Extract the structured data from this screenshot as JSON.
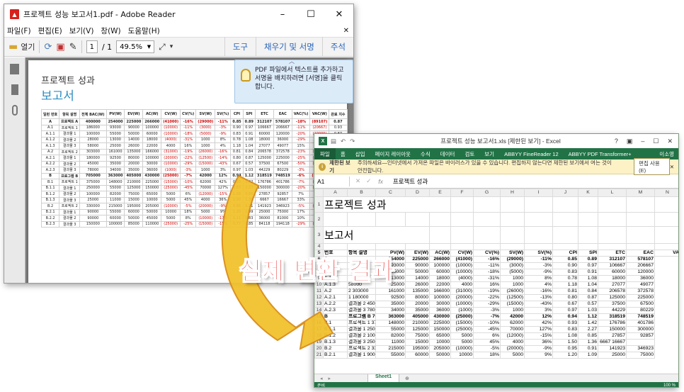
{
  "reader": {
    "title": "프로젝트 성능 보고서1.pdf - Adobe Reader",
    "menu": [
      "파일(F)",
      "편집(E)",
      "보기(V)",
      "창(W)",
      "도움말(H)"
    ],
    "toolbar": {
      "open": "열기",
      "page_current": "1",
      "page_total": "/ 1",
      "zoom": "49.5%"
    },
    "right_tabs": [
      "도구",
      "채우기 및 서명",
      "주석"
    ],
    "tip_text": "PDF 파일에서 텍스트를 추가하고 서명을 배치하려면 [서명]을 클릭합니다.",
    "page_heading": "프로젝트 성과",
    "page_subheading": "보고서",
    "table_headers": [
      "일런 번호",
      "항목 설명",
      "전체 BAC(W)",
      "PV(W)",
      "EV(W)",
      "AC(W)",
      "CV(W)",
      "CV(%)",
      "SV(W)",
      "SV(%)",
      "CPI",
      "SPI",
      "ETC",
      "EAC",
      "VAC(%)",
      "VAC(W)",
      "완료 지수"
    ],
    "table_rows": [
      [
        "A",
        "프로젝트 A",
        "400000",
        "254000",
        "225000",
        "266000",
        "(41000)",
        "-16%",
        "(29000)",
        "-11%",
        "0.85",
        "0.89",
        "312107",
        "578107",
        "-18%",
        "(89107)",
        "0.87"
      ],
      [
        "A.1",
        "프로젝트 1",
        "186000",
        "93000",
        "90000",
        "100000",
        "(10000)",
        "-11%",
        "(3000)",
        "-3%",
        "0.90",
        "0.97",
        "106667",
        "206667",
        "-11%",
        "(20667)",
        "0.93"
      ],
      [
        "A.1.1",
        "결과물 1",
        "100000",
        "55000",
        "50000",
        "60000",
        "(10000)",
        "-18%",
        "(5000)",
        "-9%",
        "0.83",
        "0.91",
        "60000",
        "120000",
        "-20%",
        "(20000)",
        "0.87"
      ],
      [
        "A.1.2",
        "결과물 2",
        "28000",
        "13000",
        "14000",
        "18000",
        "(4000)",
        "-31%",
        "1000",
        "8%",
        "0.78",
        "1.08",
        "18000",
        "36000",
        "-29%",
        "(8000)",
        "0.83"
      ],
      [
        "A.1.3",
        "결과물 3",
        "58000",
        "25000",
        "26000",
        "22000",
        "4000",
        "16%",
        "1000",
        "4%",
        "1.18",
        "1.04",
        "27077",
        "49077",
        "15%",
        "8923",
        "1.11"
      ],
      [
        "A.2",
        "프로젝트 2",
        "303000",
        "161000",
        "135000",
        "166000",
        "(31000)",
        "-19%",
        "(26000)",
        "-16%",
        "0.81",
        "0.84",
        "206578",
        "372578",
        "-23%",
        "(69578)",
        "0.83"
      ],
      [
        "A.2.1",
        "결과물 1",
        "180000",
        "92500",
        "80000",
        "100000",
        "(20000)",
        "-22%",
        "(12500)",
        "-14%",
        "0.80",
        "0.87",
        "125000",
        "225000",
        "-25%",
        "(45000)",
        "0.83"
      ],
      [
        "A.2.2",
        "결과물 2",
        "45000",
        "35000",
        "20000",
        "30000",
        "(10000)",
        "-29%",
        "(15000)",
        "-43%",
        "0.67",
        "0.57",
        "37500",
        "67500",
        "-50%",
        "(22500)",
        "0.61"
      ],
      [
        "A.2.3",
        "결과물 3",
        "78000",
        "34000",
        "35000",
        "36000",
        "(1000)",
        "-3%",
        "1000",
        "3%",
        "0.97",
        "1.03",
        "44229",
        "80229",
        "-3%",
        "(2229)",
        "1.00"
      ],
      [
        "B",
        "프로그램 B",
        "705000",
        "363000",
        "405000",
        "430000",
        "(25000)",
        "-7%",
        "42000",
        "12%",
        "0.94",
        "1.12",
        "318519",
        "748519",
        "-6%",
        "(43519)",
        "1.02"
      ],
      [
        "B.1",
        "프로젝트 1",
        "375000",
        "148000",
        "210000",
        "225000",
        "(15000)",
        "-10%",
        "62000",
        "42%",
        "0.93",
        "1.42",
        "176786",
        "401786",
        "-7%",
        "(26786)",
        "1.12"
      ],
      [
        "B.1.1",
        "결과물 1",
        "250000",
        "55000",
        "125000",
        "150000",
        "(25000)",
        "-45%",
        "70000",
        "127%",
        "0.83",
        "2.27",
        "150000",
        "300000",
        "-20%",
        "(50000)",
        "1.30"
      ],
      [
        "B.1.2",
        "결과물 2",
        "100000",
        "82000",
        "75000",
        "65000",
        "5000",
        "6%",
        "(12000)",
        "-15%",
        "1.08",
        "0.85",
        "27857",
        "92857",
        "7%",
        "7143",
        "0.97"
      ],
      [
        "B.1.3",
        "결과물 3",
        "25000",
        "11000",
        "15000",
        "10000",
        "5000",
        "45%",
        "4000",
        "36%",
        "1.50",
        "1.36",
        "6667",
        "16667",
        "33%",
        "8333",
        "1.43"
      ],
      [
        "B.2",
        "프로젝트 2",
        "330000",
        "215000",
        "195000",
        "205000",
        "(10000)",
        "-5%",
        "(20000)",
        "-9%",
        "0.95",
        "0.91",
        "141923",
        "346923",
        "-5%",
        "(16923)",
        "0.93"
      ],
      [
        "B.2.1",
        "결과물 1",
        "90000",
        "55000",
        "60000",
        "50000",
        "10000",
        "18%",
        "5000",
        "9%",
        "1.20",
        "1.09",
        "25000",
        "75000",
        "17%",
        "15000",
        "1.15"
      ],
      [
        "B.2.2",
        "결과물 2",
        "90000",
        "60000",
        "50000",
        "45000",
        "5000",
        "8%",
        "(10000)",
        "-17%",
        "1.11",
        "0.83",
        "36000",
        "81000",
        "10%",
        "9000",
        "0.97"
      ],
      [
        "B.2.3",
        "결과물 3",
        "150000",
        "100000",
        "85000",
        "110000",
        "(25000)",
        "-25%",
        "(15000)",
        "-15%",
        "0.77",
        "0.85",
        "84118",
        "194118",
        "-29%",
        "(44118)",
        "0.81"
      ]
    ]
  },
  "excel": {
    "title": "프로젝트 성능 보고서1.xls [제한된 보기] - Excel",
    "ribbon_tabs": [
      "파일",
      "홈",
      "삽입",
      "페이지 레이아웃",
      "수식",
      "데이터",
      "검토",
      "보기",
      "ABBYY FineReader 12",
      "ABBYY PDF Transformer+"
    ],
    "user": "이소영",
    "warning_label": "제한된 보기",
    "warning_text": "주의하세요—인터넷에서 가져온 파일은 바이러스가 있을 수 있습니다. 편집하지 않는다면 제한된 보기에서 여는 것이 안전합니다.",
    "enable_edit": "편집 사용(E)",
    "name_box": "A1",
    "fx": "fx",
    "formula_value": "프로젝트 성과",
    "columns": [
      "A",
      "B",
      "C",
      "D",
      "E",
      "F",
      "G",
      "H",
      "I",
      "J",
      "K",
      "L",
      "M",
      "N"
    ],
    "cell_a1": "프로젝트 성과",
    "cell_a3": "보고서",
    "header_row": [
      "번호",
      "항목 설명",
      "PV(W)",
      "EV(W)",
      "AC(W)",
      "CV(W)",
      "CV(%)",
      "SV(W)",
      "SV(%)",
      "CPI",
      "SPI",
      "ETC",
      "EAC",
      "VA"
    ],
    "rows": [
      [
        "6",
        "A",
        "",
        "254000",
        "225000",
        "266000",
        "(41000)",
        "-16%",
        "(29000)",
        "-11%",
        "0.85",
        "0.89",
        "312107",
        "578107"
      ],
      [
        "7",
        "A.1",
        "",
        "93000",
        "90000",
        "100000",
        "(10000)",
        "-11%",
        "(3000)",
        "-3%",
        "0.90",
        "0.97",
        "106667",
        "206667"
      ],
      [
        "8",
        "A.1.1",
        "",
        "55000",
        "50000",
        "60000",
        "(10000)",
        "-18%",
        "(5000)",
        "-9%",
        "0.83",
        "0.91",
        "60000",
        "120000"
      ],
      [
        "9",
        "A.1.2",
        "",
        "13000",
        "14000",
        "18000",
        "(4000)",
        "-31%",
        "1000",
        "8%",
        "0.78",
        "1.08",
        "18000",
        "36000"
      ],
      [
        "10",
        "A.1.3",
        "58000",
        "25000",
        "26000",
        "22000",
        "4000",
        "16%",
        "1000",
        "4%",
        "1.18",
        "1.04",
        "27077",
        "49077"
      ],
      [
        "11",
        "A.2",
        "2 303000",
        "161000",
        "135000",
        "166000",
        "(31000)",
        "-19%",
        "(26000)",
        "-16%",
        "0.81",
        "0.84",
        "206578",
        "372578"
      ],
      [
        "12",
        "A.2.1",
        "1 180000",
        "92500",
        "80000",
        "100000",
        "(20000)",
        "-22%",
        "(12500)",
        "-13%",
        "0.80",
        "0.87",
        "125000",
        "225000"
      ],
      [
        "13",
        "A.2.2",
        "결과물 2 45000",
        "35000",
        "20000",
        "30000",
        "(10000)",
        "-29%",
        "(15000)",
        "-43%",
        "0.67",
        "0.57",
        "37500",
        "67500"
      ],
      [
        "14",
        "A.2.3",
        "결과물 3 78000",
        "34000",
        "35000",
        "36000",
        "(1000)",
        "-3%",
        "1000",
        "3%",
        "0.97",
        "1.03",
        "44229",
        "80229"
      ],
      [
        "15",
        "B",
        "프로그램 B 705000",
        "363000",
        "405000",
        "430000",
        "(25000)",
        "-7%",
        "42000",
        "12%",
        "0.94",
        "1.12",
        "318519",
        "748519"
      ],
      [
        "16",
        "B.1",
        "프로젝트 1 375000",
        "148000",
        "210000",
        "225000",
        "(15000)",
        "-10%",
        "62000",
        "42%",
        "0.93",
        "1.42",
        "176786",
        "401786"
      ],
      [
        "17",
        "B.1.1",
        "결과물 1 250000",
        "55000",
        "125000",
        "150000",
        "(25000)",
        "-45%",
        "70000",
        "127%",
        "0.83",
        "2.27",
        "150000",
        "300000"
      ],
      [
        "18",
        "B.1.2",
        "결과물 2 100000",
        "82000",
        "75000",
        "65000",
        "5000",
        "6%",
        "(12000)",
        "-15%",
        "1.08",
        "0.85",
        "27857",
        "92857"
      ],
      [
        "19",
        "B.1.3",
        "결과물 3 25000",
        "11000",
        "15000",
        "10000",
        "5000",
        "45%",
        "4000",
        "36%",
        "1.50",
        "1.36",
        "6667 16667",
        ""
      ],
      [
        "20",
        "B.2",
        "프로젝트 2 330000",
        "215000",
        "195000",
        "205000",
        "(10000)",
        "-5%",
        "(20000)",
        "-9%",
        "0.95",
        "0.91",
        "141923",
        "346923"
      ],
      [
        "21",
        "B.2.1",
        "결과물 1 90000",
        "55000",
        "60000",
        "50000",
        "10000",
        "18%",
        "5000",
        "9%",
        "1.20",
        "1.09",
        "25000",
        "75000"
      ]
    ],
    "sheet_tab": "Sheet1",
    "status_left": "준비",
    "zoom": "100 %"
  },
  "caption": "실제 변환 결과",
  "colors": {
    "excel_green": "#217346",
    "caption_red": "#e62828",
    "arrow_fill": "#f2c02a",
    "arrow_edge": "#d88a12",
    "link_blue": "#2a63b8"
  }
}
